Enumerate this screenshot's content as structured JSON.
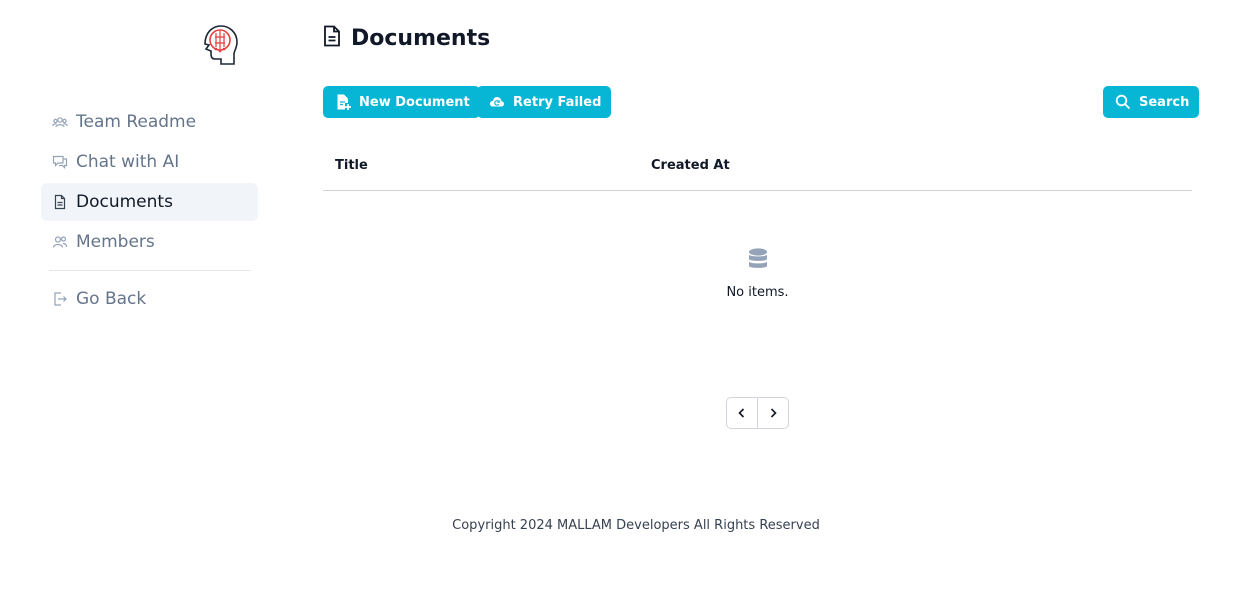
{
  "sidebar": {
    "logo_icon": "brain-circuit-icon",
    "items": [
      {
        "label": "Team Readme",
        "icon": "users-icon",
        "active": false
      },
      {
        "label": "Chat with AI",
        "icon": "chat-icon",
        "active": false
      },
      {
        "label": "Documents",
        "icon": "document-icon",
        "active": true
      },
      {
        "label": "Members",
        "icon": "members-icon",
        "active": false
      }
    ],
    "go_back_label": "Go Back"
  },
  "main": {
    "title": "Documents",
    "toolbar": {
      "new_document_label": "New Document",
      "retry_failed_label": "Retry Failed",
      "search_label": "Search"
    },
    "table": {
      "columns": [
        "Title",
        "Created At"
      ],
      "rows": [],
      "empty_text": "No items."
    }
  },
  "footer": {
    "text": "Copyright 2024 MALLAM Developers All Rights Reserved"
  },
  "colors": {
    "accent": "#06b6d4",
    "active_bg": "#f1f5f9",
    "muted_text": "#64748b",
    "logo_red": "#e53e3e"
  }
}
